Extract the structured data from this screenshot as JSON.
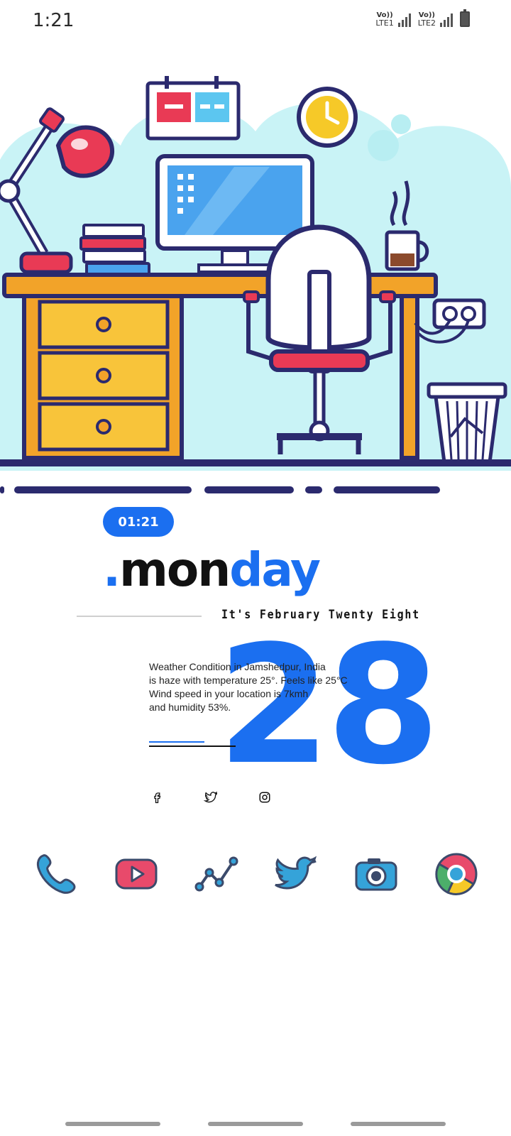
{
  "status_bar": {
    "time": "1:21",
    "sim1_top": "Vo))",
    "sim1_bottom": "LTE1",
    "sim2_top": "Vo))",
    "sim2_bottom": "LTE2",
    "icons": [
      "signal-icon",
      "signal-icon",
      "battery-icon"
    ]
  },
  "illustration": {
    "description_icon": "desk-workspace-illustration"
  },
  "widget": {
    "time_pill": "01:21",
    "day_dot": ".",
    "day_part1": "mon",
    "day_part2": "day",
    "date_line": "It's February Twenty Eight",
    "big_date": "28",
    "weather_lines": [
      "Weather Condition in Jamshedpur, India",
      "is haze with temperature 25°. Feels like 25°C",
      "Wind speed in your location is 7kmh",
      "and humidity 53%."
    ]
  },
  "social": [
    "facebook-icon",
    "twitter-icon",
    "instagram-icon"
  ],
  "dock": [
    "phone-icon",
    "youtube-icon",
    "analytics-icon",
    "twitter-icon",
    "camera-icon",
    "chrome-icon"
  ],
  "colors": {
    "accent": "#1b6ff0",
    "dock_blue": "#35a3d9",
    "dock_pink": "#e84a6b",
    "dock_outline": "#3b4a6b"
  }
}
